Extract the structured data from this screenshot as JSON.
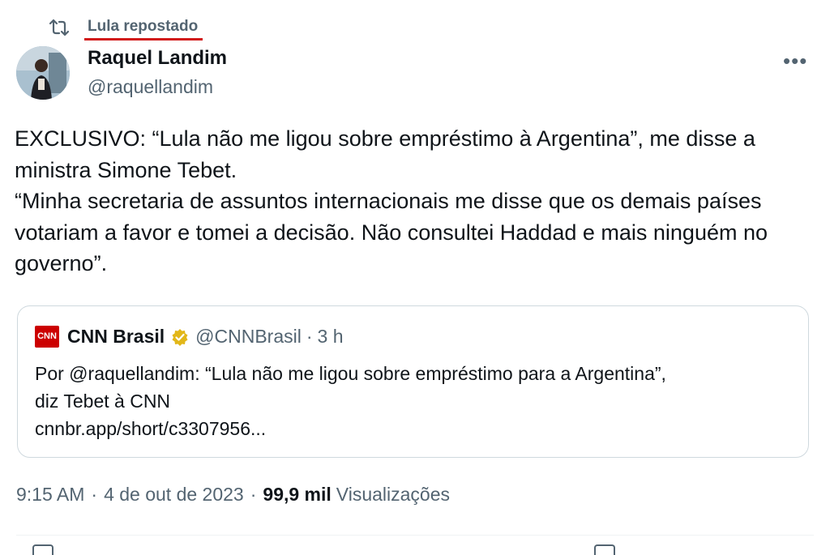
{
  "repost": {
    "label": "Lula repostado",
    "icon": "repost-icon"
  },
  "author": {
    "name": "Raquel Landim",
    "handle": "@raquellandim",
    "avatar_icon": "avatar"
  },
  "more_icon": "more-icon",
  "tweet_text": "EXCLUSIVO: “Lula não me ligou sobre empréstimo à Argentina”, me disse a ministra Simone Tebet.\n“Minha secretaria de assuntos internacionais me disse que os demais países votariam a favor e tomei a decisão. Não consultei Haddad e mais ninguém no governo”.",
  "quoted": {
    "logo_text": "CNN",
    "name": "CNN Brasil",
    "verified_icon": "gold-verified-badge-icon",
    "handle": "@CNNBrasil",
    "dot": "·",
    "time": "3 h",
    "text": "Por @raquellandim:  “Lula não me ligou sobre empréstimo para a Argentina”,\ndiz Tebet à CNN\ncnnbr.app/short/c3307956..."
  },
  "meta": {
    "time": "9:15 AM",
    "dot": "·",
    "date": "4 de out de 2023",
    "views_count": "99,9 mil",
    "views_label": "Visualizações"
  },
  "colors": {
    "secondary_text": "#536471",
    "primary_text": "#0f1419",
    "underline": "#d11b1b",
    "cnn_red": "#cc0000",
    "verified_gold": "#e2b719"
  }
}
